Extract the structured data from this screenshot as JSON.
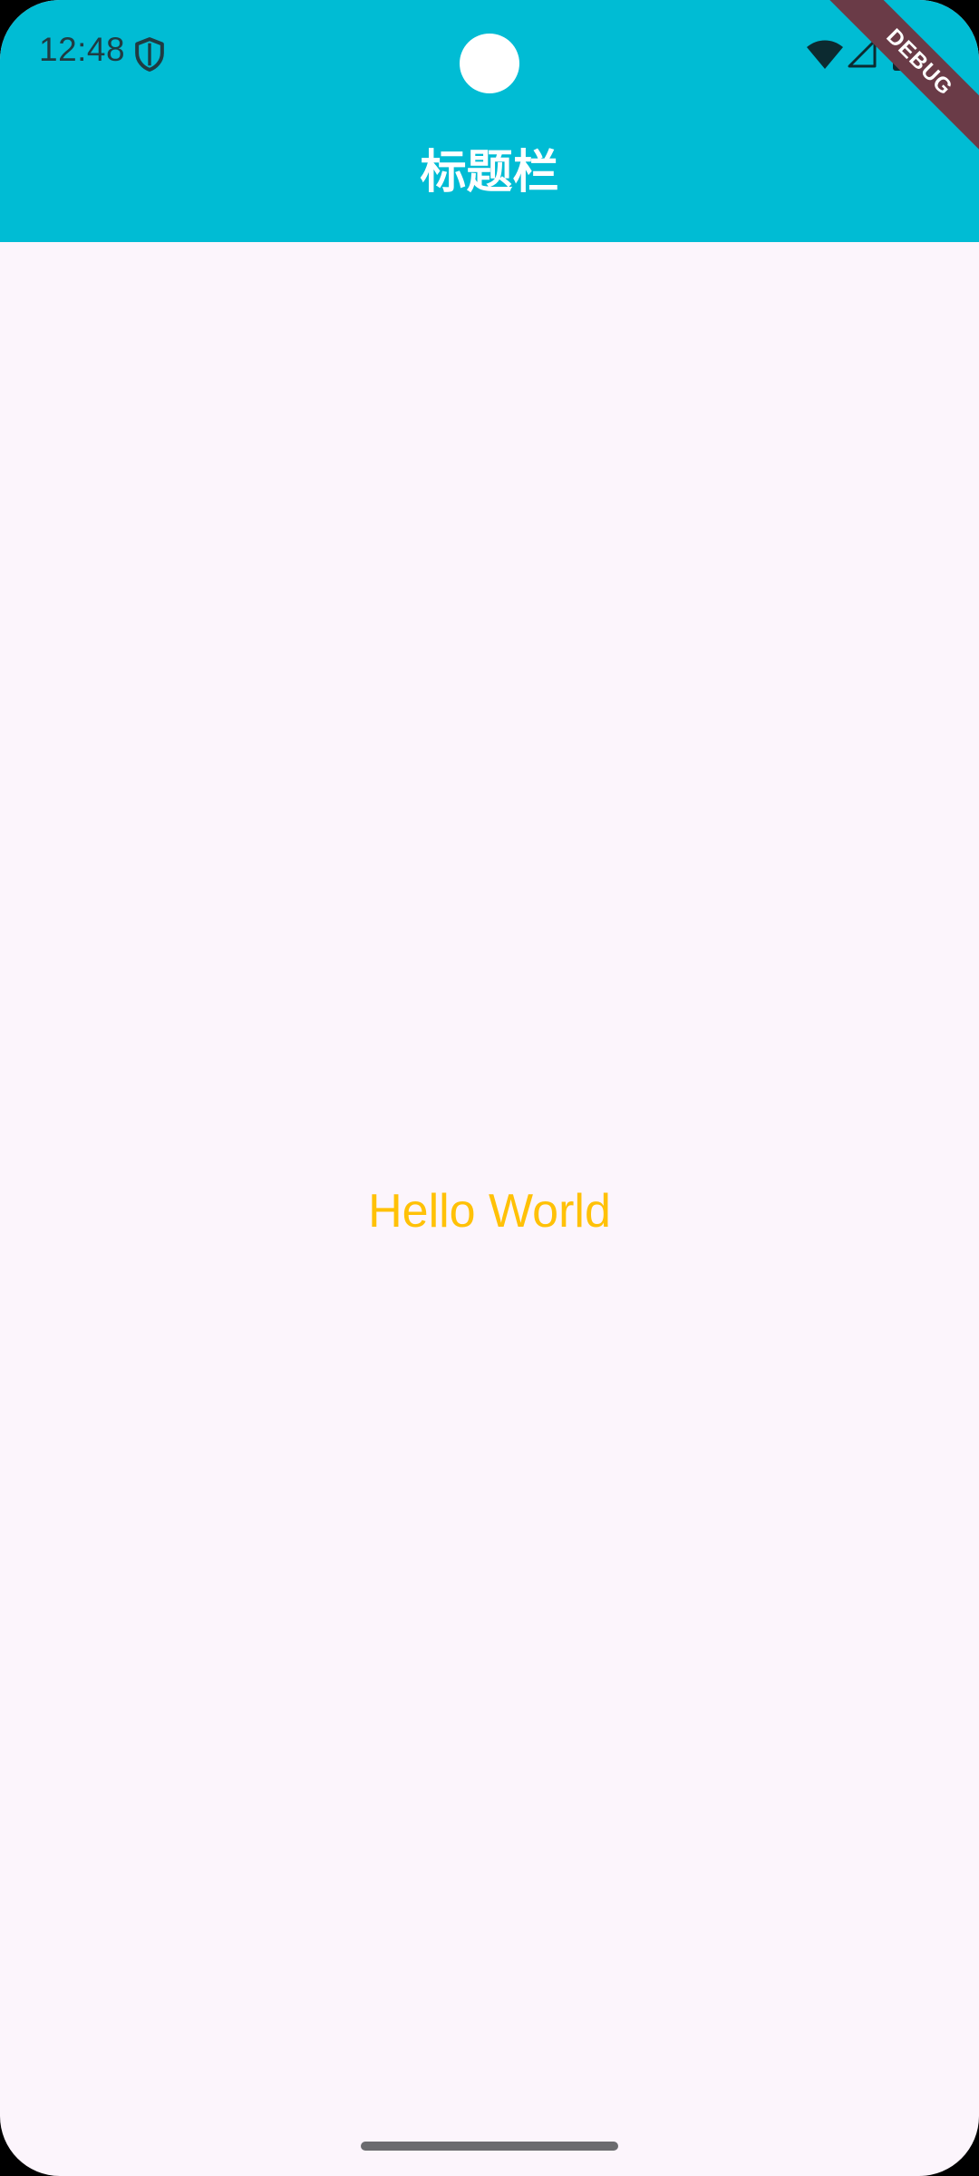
{
  "status_bar": {
    "time": "12:48",
    "icons": [
      "shield-icon",
      "wifi-icon",
      "cellular-signal-icon",
      "battery-icon"
    ]
  },
  "app_bar": {
    "title": "标题栏",
    "color": "#00BCD4"
  },
  "debug_banner": {
    "label": "DEBUG",
    "color": "#6A3B47"
  },
  "body": {
    "text": "Hello World",
    "text_color": "#FFC107",
    "background": "#FCF5FC"
  }
}
